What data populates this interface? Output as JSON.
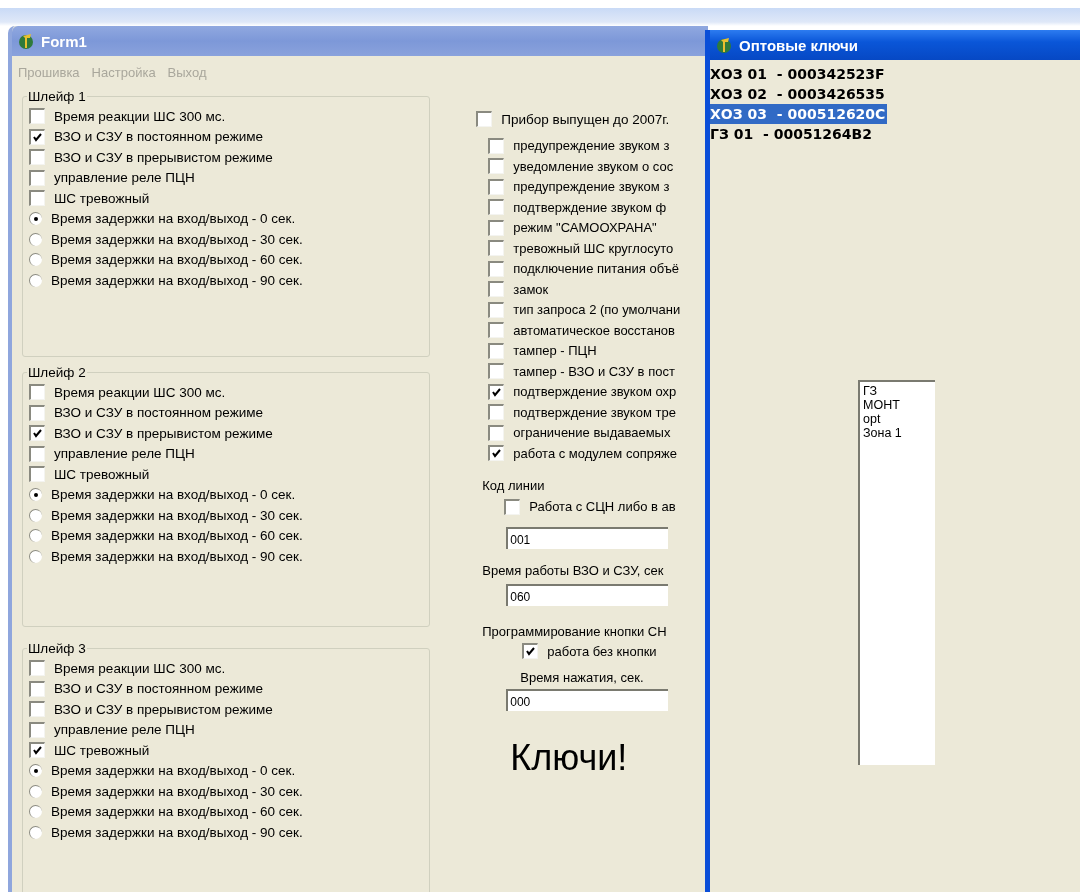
{
  "form_window": {
    "title": "Form1"
  },
  "menu": [
    {
      "label": "Прошивка",
      "disabled": true
    },
    {
      "label": "Настройка",
      "disabled": true
    },
    {
      "label": "Выход",
      "disabled": true
    }
  ],
  "loops": [
    {
      "title": "Шлейф 1",
      "options": [
        {
          "kind": "checkbox",
          "label": "Время реакции ШС 300 мс.",
          "checked": false
        },
        {
          "kind": "checkbox",
          "label": "ВЗО и СЗУ в постоянном режиме",
          "checked": true
        },
        {
          "kind": "checkbox",
          "label": "ВЗО и СЗУ в прерывистом режиме",
          "checked": false
        },
        {
          "kind": "checkbox",
          "label": "управление реле ПЦН",
          "checked": false
        },
        {
          "kind": "checkbox",
          "label": "ШС тревожный",
          "checked": false
        },
        {
          "kind": "radio",
          "label": "Время задержки на вход/выход -  0 сек.",
          "selected": true
        },
        {
          "kind": "radio",
          "label": "Время задержки на вход/выход - 30 сек.",
          "selected": false
        },
        {
          "kind": "radio",
          "label": "Время задержки на вход/выход - 60 сек.",
          "selected": false
        },
        {
          "kind": "radio",
          "label": "Время задержки на вход/выход - 90 сек.",
          "selected": false
        }
      ]
    },
    {
      "title": "Шлейф 2",
      "options": [
        {
          "kind": "checkbox",
          "label": "Время реакции ШС 300 мс.",
          "checked": false
        },
        {
          "kind": "checkbox",
          "label": "ВЗО и СЗУ в постоянном режиме",
          "checked": false
        },
        {
          "kind": "checkbox",
          "label": "ВЗО и СЗУ в прерывистом режиме",
          "checked": true
        },
        {
          "kind": "checkbox",
          "label": "управление реле ПЦН",
          "checked": false
        },
        {
          "kind": "checkbox",
          "label": "ШС тревожный",
          "checked": false
        },
        {
          "kind": "radio",
          "label": "Время задержки на вход/выход -  0 сек.",
          "selected": true
        },
        {
          "kind": "radio",
          "label": "Время задержки на вход/выход - 30 сек.",
          "selected": false
        },
        {
          "kind": "radio",
          "label": "Время задержки на вход/выход - 60 сек.",
          "selected": false
        },
        {
          "kind": "radio",
          "label": "Время задержки на вход/выход - 90 сек.",
          "selected": false
        }
      ]
    },
    {
      "title": "Шлейф 3",
      "options": [
        {
          "kind": "checkbox",
          "label": "Время реакции ШС 300 мс.",
          "checked": false
        },
        {
          "kind": "checkbox",
          "label": "ВЗО и СЗУ в постоянном режиме",
          "checked": false
        },
        {
          "kind": "checkbox",
          "label": "ВЗО и СЗУ в прерывистом режиме",
          "checked": false
        },
        {
          "kind": "checkbox",
          "label": "управление реле ПЦН",
          "checked": false
        },
        {
          "kind": "checkbox",
          "label": "ШС тревожный",
          "checked": true
        },
        {
          "kind": "radio",
          "label": "Время задержки на вход/выход -  0 сек.",
          "selected": true
        },
        {
          "kind": "radio",
          "label": "Время задержки на вход/выход - 30 сек.",
          "selected": false
        },
        {
          "kind": "radio",
          "label": "Время задержки на вход/выход - 60 сек.",
          "selected": false
        },
        {
          "kind": "radio",
          "label": "Время задержки на вход/выход - 90 сек.",
          "selected": false
        }
      ]
    }
  ],
  "device_before_2007": {
    "label": "Прибор выпущен до 2007г.",
    "checked": false
  },
  "options": [
    {
      "label": "предупреждение звуком з",
      "checked": false
    },
    {
      "label": "уведомление звуком о сос",
      "checked": false
    },
    {
      "label": "предупреждение звуком з",
      "checked": false
    },
    {
      "label": "подтверждение звуком ф",
      "checked": false
    },
    {
      "label": "режим \"САМООХРАНА\"",
      "checked": false
    },
    {
      "label": "тревожный ШС круглосуто",
      "checked": false
    },
    {
      "label": "подключение питания объё",
      "checked": false
    },
    {
      "label": "замок",
      "checked": false
    },
    {
      "label": "тип запроса 2 (по умолчани",
      "checked": false
    },
    {
      "label": "автоматическое восстанов",
      "checked": false
    },
    {
      "label": "тампер - ПЦН",
      "checked": false
    },
    {
      "label": "тампер - ВЗО и СЗУ в пост",
      "checked": false
    },
    {
      "label": "подтверждение звуком охр",
      "checked": true
    },
    {
      "label": "подтверждение звуком тре",
      "checked": false
    },
    {
      "label": "ограничение выдаваемых",
      "checked": false
    },
    {
      "label": "работа с модулем сопряже",
      "checked": true
    }
  ],
  "line_code": {
    "label": "Код линии",
    "checkbox": {
      "label": "Работа с СЦН либо в ав",
      "checked": false
    },
    "value": "001"
  },
  "vzo_time": {
    "label": "Время работы ВЗО и СЗУ, сек",
    "value": "060"
  },
  "button_programming": {
    "label": "Программирование кнопки СН",
    "checkbox": {
      "label": "работа без кнопки",
      "checked": true
    },
    "press_time_label": "Время нажатия, сек.",
    "value": "000"
  },
  "keys_label": "Ключи!",
  "keys_window": {
    "title": "Оптовые ключи",
    "keys": [
      {
        "text": "ХОЗ 01  - 000342523F",
        "selected": false
      },
      {
        "text": "ХОЗ 02  - 0003426535",
        "selected": false
      },
      {
        "text": "ХОЗ 03  - 000512620C",
        "selected": true
      },
      {
        "text": "ГЗ 01  - 00051264B2",
        "selected": false
      }
    ],
    "listbox": [
      "ГЗ",
      "МОНТ",
      "opt",
      "Зона 1"
    ]
  }
}
